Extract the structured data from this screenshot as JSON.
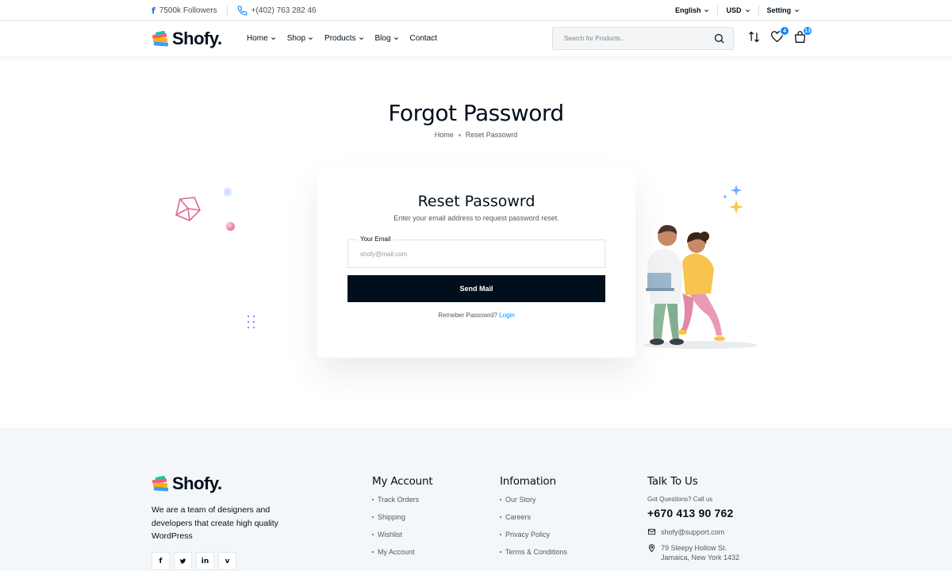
{
  "topbar": {
    "followers": "7500k Followers",
    "phone": "+(402) 763 282 46",
    "language": "English",
    "currency": "USD",
    "setting": "Setting"
  },
  "header": {
    "logo": "Shofy.",
    "nav": [
      {
        "label": "Home",
        "has_dropdown": true
      },
      {
        "label": "Shop",
        "has_dropdown": true
      },
      {
        "label": "Products",
        "has_dropdown": true
      },
      {
        "label": "Blog",
        "has_dropdown": true
      },
      {
        "label": "Contact",
        "has_dropdown": false
      }
    ],
    "search_placeholder": "Search for Products...",
    "wishlist_count": "4",
    "cart_count": "13",
    "icons": [
      "compare-icon",
      "heart-icon",
      "cart-icon",
      "search-icon"
    ]
  },
  "page": {
    "title": "Forgot Password",
    "breadcrumb": [
      "Home",
      "Reset Passowrd"
    ]
  },
  "form": {
    "title": "Reset Passowrd",
    "subtitle": "Enter your email address to request password reset.",
    "email_label": "Your Email",
    "email_placeholder": "shofy@mail.com",
    "email_value": "",
    "submit_label": "Send Mail",
    "remember_text": "Remeber Passowrd?",
    "login_label": "Login"
  },
  "footer": {
    "logo": "Shofy.",
    "description": "We are a team of designers and developers that create high quality WordPress",
    "socials": [
      "f",
      "t",
      "in",
      "v"
    ],
    "my_account": {
      "title": "My Account",
      "items": [
        "Track Orders",
        "Shipping",
        "Wishlist",
        "My Account"
      ]
    },
    "information": {
      "title": "Infomation",
      "items": [
        "Our Story",
        "Careers",
        "Privacy Policy",
        "Terms & Conditions"
      ]
    },
    "talk": {
      "title": "Talk To Us",
      "question": "Got Questions? Call us",
      "phone": "+670 413 90 762",
      "email": "shofy@support.com",
      "address_line1": "79 Sleepy Hollow St.",
      "address_line2": "Jamaica, New York 1432"
    }
  },
  "colors": {
    "primary_dark": "#010f1c",
    "accent_blue": "#0989ff",
    "footer_bg": "#f4f7f9",
    "text_muted": "#55585b"
  }
}
